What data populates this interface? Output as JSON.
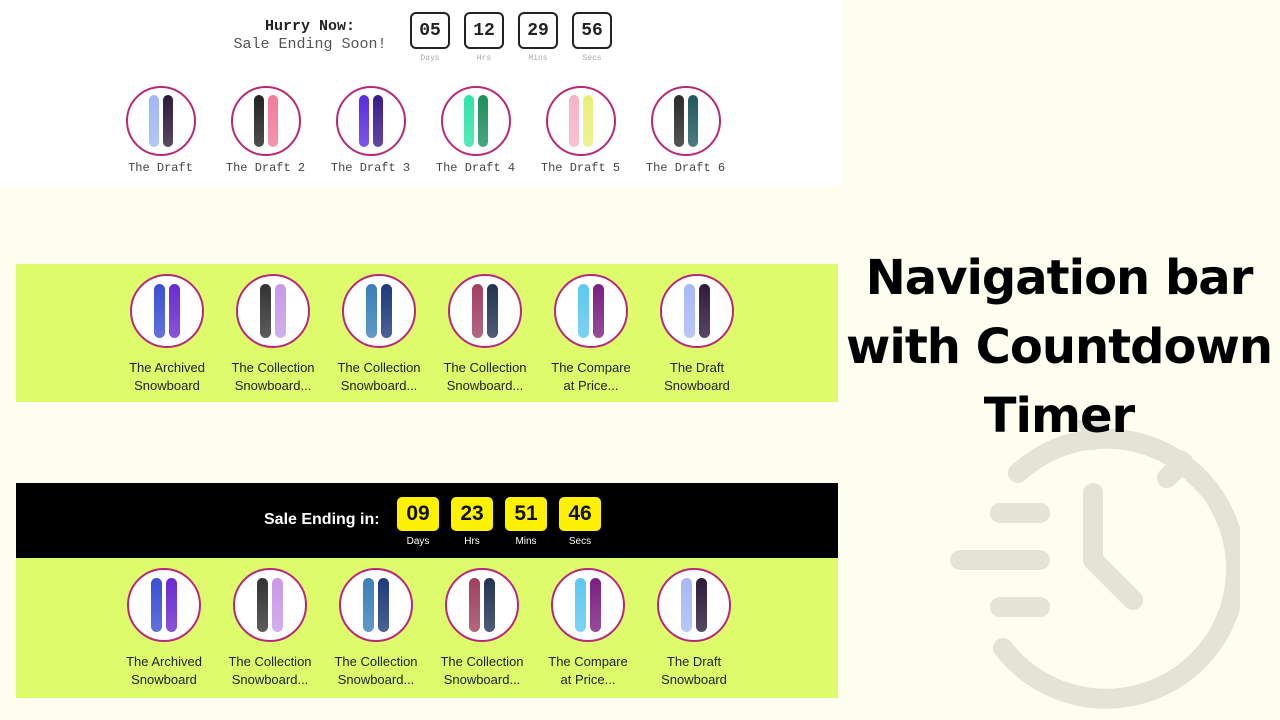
{
  "panel1": {
    "hurry": "Hurry Now:",
    "sale": "Sale Ending Soon!",
    "timer": [
      {
        "value": "05",
        "label": "Days"
      },
      {
        "value": "12",
        "label": "Hrs"
      },
      {
        "value": "29",
        "label": "Mins"
      },
      {
        "value": "56",
        "label": "Secs"
      }
    ],
    "items": [
      {
        "name": "The Draft",
        "colors": [
          "#9fb7f5",
          "#2e1a3a"
        ]
      },
      {
        "name": "The Draft 2",
        "colors": [
          "#222222",
          "#f47a9a"
        ]
      },
      {
        "name": "The Draft 3",
        "colors": [
          "#5b2de0",
          "#3a1a8c"
        ]
      },
      {
        "name": "The Draft 4",
        "colors": [
          "#2fe3a8",
          "#1c8f5e"
        ]
      },
      {
        "name": "The Draft 5",
        "colors": [
          "#f5b3c6",
          "#e8f07a"
        ]
      },
      {
        "name": "The Draft 6",
        "colors": [
          "#2a2a2a",
          "#1f5a5e"
        ]
      }
    ],
    "accent": "#b8287a"
  },
  "panel2": {
    "items": [
      {
        "name_line1": "The Archived",
        "name_line2": "Snowboard",
        "colors": [
          "#3a4fd4",
          "#6a2ad0"
        ]
      },
      {
        "name_line1": "The Collection",
        "name_line2": "Snowboard...",
        "colors": [
          "#333333",
          "#c79ae8"
        ]
      },
      {
        "name_line1": "The Collection",
        "name_line2": "Snowboard...",
        "colors": [
          "#3a7fb8",
          "#1e3a7a"
        ]
      },
      {
        "name_line1": "The Collection",
        "name_line2": "Snowboard...",
        "colors": [
          "#a04060",
          "#223355"
        ]
      },
      {
        "name_line1": "The Compare",
        "name_line2": "at Price...",
        "colors": [
          "#5cc8f0",
          "#7a2080"
        ]
      },
      {
        "name_line1": "The Draft",
        "name_line2": "Snowboard",
        "colors": [
          "#a8b8f8",
          "#2e1a3a"
        ]
      }
    ]
  },
  "panel3": {
    "title": "Sale Ending in:",
    "timer": [
      {
        "value": "09",
        "label": "Days"
      },
      {
        "value": "23",
        "label": "Hrs"
      },
      {
        "value": "51",
        "label": "Mins"
      },
      {
        "value": "46",
        "label": "Secs"
      }
    ],
    "items": [
      {
        "name_line1": "The Archived",
        "name_line2": "Snowboard",
        "colors": [
          "#3a4fd4",
          "#6a2ad0"
        ]
      },
      {
        "name_line1": "The Collection",
        "name_line2": "Snowboard...",
        "colors": [
          "#333333",
          "#c79ae8"
        ]
      },
      {
        "name_line1": "The Collection",
        "name_line2": "Snowboard...",
        "colors": [
          "#3a7fb8",
          "#1e3a7a"
        ]
      },
      {
        "name_line1": "The Collection",
        "name_line2": "Snowboard...",
        "colors": [
          "#a04060",
          "#223355"
        ]
      },
      {
        "name_line1": "The Compare",
        "name_line2": "at Price...",
        "colors": [
          "#5cc8f0",
          "#7a2080"
        ]
      },
      {
        "name_line1": "The Draft",
        "name_line2": "Snowboard",
        "colors": [
          "#a8b8f8",
          "#2e1a3a"
        ]
      }
    ],
    "timer_color": "#fff200",
    "bar_color": "#000000",
    "row_color": "#ddfb6a"
  },
  "headline": {
    "line1": "Navigation bar",
    "line2": "with Countdown",
    "line3": "Timer"
  },
  "icons": {
    "background": "stopwatch-icon"
  }
}
